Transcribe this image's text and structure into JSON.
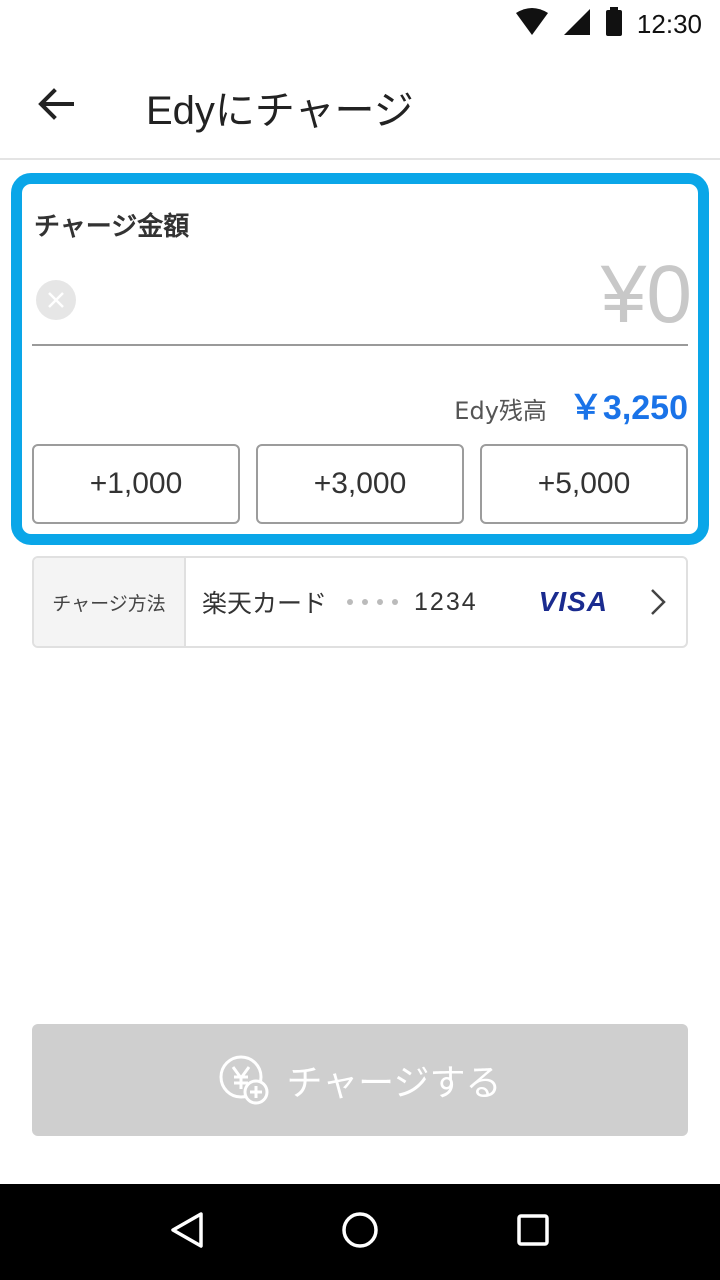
{
  "status_bar": {
    "time": "12:30",
    "icons": [
      "wifi-icon",
      "signal-icon",
      "battery-icon"
    ]
  },
  "app_bar": {
    "title": "Edyにチャージ",
    "back_icon": "arrow-left-icon"
  },
  "charge": {
    "label": "チャージ金額",
    "amount": "¥0",
    "balance_label": "Edy残高",
    "balance_value": "￥3,250",
    "quick_buttons": [
      "+1,000",
      "+3,000",
      "+5,000"
    ]
  },
  "method": {
    "label": "チャージ方法",
    "card_name": "楽天カード",
    "last4": "1234",
    "brand": "VISA"
  },
  "charge_button": {
    "label": "チャージする"
  },
  "colors": {
    "accent": "#0aa6e8",
    "balance": "#1a73e8",
    "visa": "#1a2b8f",
    "disabled": "#cfcfcf"
  }
}
